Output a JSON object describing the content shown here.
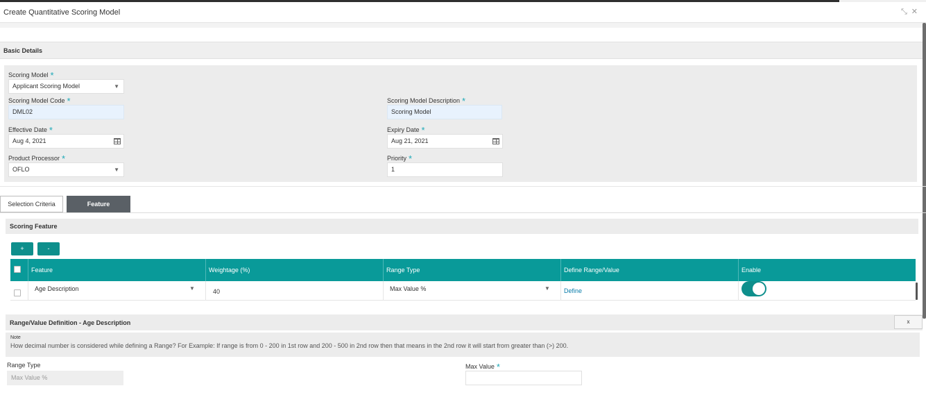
{
  "window": {
    "title": "Create Quantitative Scoring Model",
    "icons": [
      "collapse-icon",
      "close-icon"
    ]
  },
  "basic_details": {
    "section_title": "Basic Details",
    "scoring_model": {
      "label": "Scoring Model",
      "required": "*",
      "value": "Applicant Scoring Model"
    },
    "scoring_model_code": {
      "label": "Scoring Model Code",
      "required": "*",
      "value": "DML02"
    },
    "scoring_model_description": {
      "label": "Scoring Model Description",
      "required": "*",
      "value": "Scoring Model"
    },
    "effective_date": {
      "label": "Effective Date",
      "required": "*",
      "value": "Aug 4, 2021"
    },
    "expiry_date": {
      "label": "Expiry Date",
      "required": "*",
      "value": "Aug 21, 2021"
    },
    "product_processor": {
      "label": "Product Processor",
      "required": "*",
      "value": "OFLO"
    },
    "priority": {
      "label": "Priority",
      "required": "*",
      "value": "1"
    }
  },
  "tabs": [
    {
      "label": "Selection Criteria",
      "active": false
    },
    {
      "label": "Feature",
      "active": true
    }
  ],
  "scoring_feature": {
    "title": "Scoring Feature",
    "add_label": "+",
    "remove_label": "-",
    "columns": [
      "Feature",
      "Weightage (%)",
      "Range Type",
      "Define Range/Value",
      "Enable"
    ],
    "rows": [
      {
        "feature": "Age Description",
        "weightage": "40",
        "range_type": "Max Value %",
        "define": "Define",
        "enabled": true
      }
    ]
  },
  "range_definition": {
    "title": "Range/Value Definition - Age Description",
    "close_label": "x",
    "note_title": "Note",
    "note_text": "How decimal number is considered while defining a Range? For Example: If range is from 0 - 200 in 1st row and 200 - 500 in 2nd row then that means in the 2nd row it will start from greater than (>) 200.",
    "range_type": {
      "label": "Range Type",
      "value": "Max Value %"
    },
    "max_value": {
      "label": "Max Value",
      "required": "*",
      "value": ""
    }
  },
  "colors": {
    "accent": "#099a99",
    "button": "#0e8f8c",
    "active_tab": "#5a6066",
    "required_marker": "#1fa9b8",
    "link": "#0a7dab"
  }
}
